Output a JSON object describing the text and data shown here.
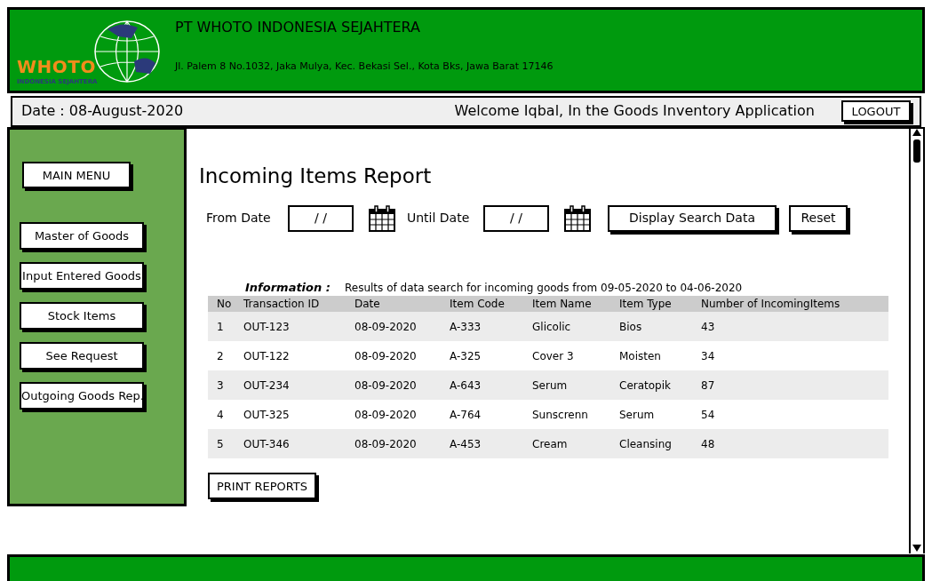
{
  "header": {
    "logo_text": "WHOTO",
    "logo_subtext": "INDONESIA SEJAHTERA",
    "company": "PT WHOTO INDONESIA SEJAHTERA",
    "address": "Jl. Palem 8 No.1032, Jaka Mulya, Kec. Bekasi Sel., Kota Bks, Jawa Barat 17146"
  },
  "topbar": {
    "date": "Date : 08-August-2020",
    "welcome": "Welcome Iqbal, In the Goods Inventory Application",
    "logout": "LOGOUT"
  },
  "sidebar": {
    "main_menu": "MAIN MENU",
    "items": [
      "Master of Goods",
      "Input Entered Goods",
      "Stock Items",
      "See Request",
      "Outgoing Goods Rep."
    ]
  },
  "report": {
    "title": "Incoming Items Report",
    "from_label": "From Date",
    "from_value": "/ /",
    "until_label": "Until Date",
    "until_value": "/ /",
    "search_button": "Display Search Data",
    "reset_button": "Reset",
    "info_label": "Information :",
    "info_text": "Results of data search for incoming goods from 09-05-2020 to 04-06-2020",
    "columns": [
      "No",
      "Transaction ID",
      "Date",
      "Item Code",
      "Item Name",
      "Item Type",
      "Number of IncomingItems"
    ],
    "rows": [
      [
        "1",
        "OUT-123",
        "08-09-2020",
        "A-333",
        "Glicolic",
        "Bios",
        "43"
      ],
      [
        "2",
        "OUT-122",
        "08-09-2020",
        "A-325",
        "Cover 3",
        "Moisten",
        "34"
      ],
      [
        "3",
        "OUT-234",
        "08-09-2020",
        "A-643",
        "Serum",
        "Ceratopik",
        "87"
      ],
      [
        "4",
        "OUT-325",
        "08-09-2020",
        "A-764",
        "Sunscrenn",
        "Serum",
        "54"
      ],
      [
        "5",
        "OUT-346",
        "08-09-2020",
        "A-453",
        "Cream",
        "Cleansing",
        "48"
      ]
    ],
    "print_button": "PRINT REPORTS"
  }
}
